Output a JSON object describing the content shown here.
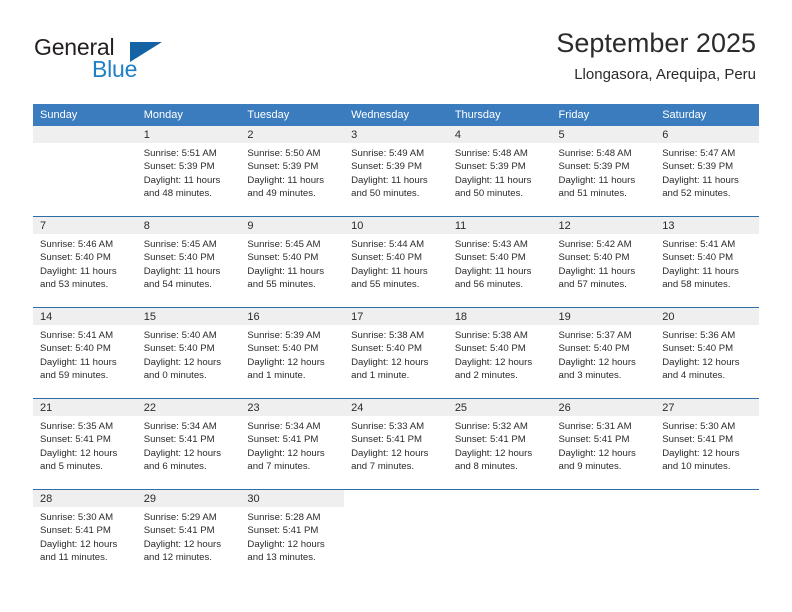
{
  "brand": {
    "name_part1": "General",
    "name_part2": "Blue",
    "triangle_color": "#1464a5",
    "blue_text_color": "#1f7fc4"
  },
  "header": {
    "title": "September 2025",
    "subtitle": "Llongasora, Arequipa, Peru"
  },
  "theme": {
    "header_bg": "#3a7cbe",
    "row_divider": "#2f6da9",
    "daynum_bg": "#efefef",
    "cell_bg": "#ffffff",
    "text": "#2b2b2b"
  },
  "weekday_headers": [
    "Sunday",
    "Monday",
    "Tuesday",
    "Wednesday",
    "Thursday",
    "Friday",
    "Saturday"
  ],
  "weeks": [
    {
      "days": [
        {
          "day": "",
          "empty": true,
          "sunrise": "",
          "sunset": "",
          "daylight_line1": "",
          "daylight_line2": ""
        },
        {
          "day": "1",
          "sunrise": "Sunrise: 5:51 AM",
          "sunset": "Sunset: 5:39 PM",
          "daylight_line1": "Daylight: 11 hours",
          "daylight_line2": "and 48 minutes."
        },
        {
          "day": "2",
          "sunrise": "Sunrise: 5:50 AM",
          "sunset": "Sunset: 5:39 PM",
          "daylight_line1": "Daylight: 11 hours",
          "daylight_line2": "and 49 minutes."
        },
        {
          "day": "3",
          "sunrise": "Sunrise: 5:49 AM",
          "sunset": "Sunset: 5:39 PM",
          "daylight_line1": "Daylight: 11 hours",
          "daylight_line2": "and 50 minutes."
        },
        {
          "day": "4",
          "sunrise": "Sunrise: 5:48 AM",
          "sunset": "Sunset: 5:39 PM",
          "daylight_line1": "Daylight: 11 hours",
          "daylight_line2": "and 50 minutes."
        },
        {
          "day": "5",
          "sunrise": "Sunrise: 5:48 AM",
          "sunset": "Sunset: 5:39 PM",
          "daylight_line1": "Daylight: 11 hours",
          "daylight_line2": "and 51 minutes."
        },
        {
          "day": "6",
          "sunrise": "Sunrise: 5:47 AM",
          "sunset": "Sunset: 5:39 PM",
          "daylight_line1": "Daylight: 11 hours",
          "daylight_line2": "and 52 minutes."
        }
      ]
    },
    {
      "days": [
        {
          "day": "7",
          "sunrise": "Sunrise: 5:46 AM",
          "sunset": "Sunset: 5:40 PM",
          "daylight_line1": "Daylight: 11 hours",
          "daylight_line2": "and 53 minutes."
        },
        {
          "day": "8",
          "sunrise": "Sunrise: 5:45 AM",
          "sunset": "Sunset: 5:40 PM",
          "daylight_line1": "Daylight: 11 hours",
          "daylight_line2": "and 54 minutes."
        },
        {
          "day": "9",
          "sunrise": "Sunrise: 5:45 AM",
          "sunset": "Sunset: 5:40 PM",
          "daylight_line1": "Daylight: 11 hours",
          "daylight_line2": "and 55 minutes."
        },
        {
          "day": "10",
          "sunrise": "Sunrise: 5:44 AM",
          "sunset": "Sunset: 5:40 PM",
          "daylight_line1": "Daylight: 11 hours",
          "daylight_line2": "and 55 minutes."
        },
        {
          "day": "11",
          "sunrise": "Sunrise: 5:43 AM",
          "sunset": "Sunset: 5:40 PM",
          "daylight_line1": "Daylight: 11 hours",
          "daylight_line2": "and 56 minutes."
        },
        {
          "day": "12",
          "sunrise": "Sunrise: 5:42 AM",
          "sunset": "Sunset: 5:40 PM",
          "daylight_line1": "Daylight: 11 hours",
          "daylight_line2": "and 57 minutes."
        },
        {
          "day": "13",
          "sunrise": "Sunrise: 5:41 AM",
          "sunset": "Sunset: 5:40 PM",
          "daylight_line1": "Daylight: 11 hours",
          "daylight_line2": "and 58 minutes."
        }
      ]
    },
    {
      "days": [
        {
          "day": "14",
          "sunrise": "Sunrise: 5:41 AM",
          "sunset": "Sunset: 5:40 PM",
          "daylight_line1": "Daylight: 11 hours",
          "daylight_line2": "and 59 minutes."
        },
        {
          "day": "15",
          "sunrise": "Sunrise: 5:40 AM",
          "sunset": "Sunset: 5:40 PM",
          "daylight_line1": "Daylight: 12 hours",
          "daylight_line2": "and 0 minutes."
        },
        {
          "day": "16",
          "sunrise": "Sunrise: 5:39 AM",
          "sunset": "Sunset: 5:40 PM",
          "daylight_line1": "Daylight: 12 hours",
          "daylight_line2": "and 1 minute."
        },
        {
          "day": "17",
          "sunrise": "Sunrise: 5:38 AM",
          "sunset": "Sunset: 5:40 PM",
          "daylight_line1": "Daylight: 12 hours",
          "daylight_line2": "and 1 minute."
        },
        {
          "day": "18",
          "sunrise": "Sunrise: 5:38 AM",
          "sunset": "Sunset: 5:40 PM",
          "daylight_line1": "Daylight: 12 hours",
          "daylight_line2": "and 2 minutes."
        },
        {
          "day": "19",
          "sunrise": "Sunrise: 5:37 AM",
          "sunset": "Sunset: 5:40 PM",
          "daylight_line1": "Daylight: 12 hours",
          "daylight_line2": "and 3 minutes."
        },
        {
          "day": "20",
          "sunrise": "Sunrise: 5:36 AM",
          "sunset": "Sunset: 5:40 PM",
          "daylight_line1": "Daylight: 12 hours",
          "daylight_line2": "and 4 minutes."
        }
      ]
    },
    {
      "days": [
        {
          "day": "21",
          "sunrise": "Sunrise: 5:35 AM",
          "sunset": "Sunset: 5:41 PM",
          "daylight_line1": "Daylight: 12 hours",
          "daylight_line2": "and 5 minutes."
        },
        {
          "day": "22",
          "sunrise": "Sunrise: 5:34 AM",
          "sunset": "Sunset: 5:41 PM",
          "daylight_line1": "Daylight: 12 hours",
          "daylight_line2": "and 6 minutes."
        },
        {
          "day": "23",
          "sunrise": "Sunrise: 5:34 AM",
          "sunset": "Sunset: 5:41 PM",
          "daylight_line1": "Daylight: 12 hours",
          "daylight_line2": "and 7 minutes."
        },
        {
          "day": "24",
          "sunrise": "Sunrise: 5:33 AM",
          "sunset": "Sunset: 5:41 PM",
          "daylight_line1": "Daylight: 12 hours",
          "daylight_line2": "and 7 minutes."
        },
        {
          "day": "25",
          "sunrise": "Sunrise: 5:32 AM",
          "sunset": "Sunset: 5:41 PM",
          "daylight_line1": "Daylight: 12 hours",
          "daylight_line2": "and 8 minutes."
        },
        {
          "day": "26",
          "sunrise": "Sunrise: 5:31 AM",
          "sunset": "Sunset: 5:41 PM",
          "daylight_line1": "Daylight: 12 hours",
          "daylight_line2": "and 9 minutes."
        },
        {
          "day": "27",
          "sunrise": "Sunrise: 5:30 AM",
          "sunset": "Sunset: 5:41 PM",
          "daylight_line1": "Daylight: 12 hours",
          "daylight_line2": "and 10 minutes."
        }
      ]
    },
    {
      "days": [
        {
          "day": "28",
          "sunrise": "Sunrise: 5:30 AM",
          "sunset": "Sunset: 5:41 PM",
          "daylight_line1": "Daylight: 12 hours",
          "daylight_line2": "and 11 minutes."
        },
        {
          "day": "29",
          "sunrise": "Sunrise: 5:29 AM",
          "sunset": "Sunset: 5:41 PM",
          "daylight_line1": "Daylight: 12 hours",
          "daylight_line2": "and 12 minutes."
        },
        {
          "day": "30",
          "sunrise": "Sunrise: 5:28 AM",
          "sunset": "Sunset: 5:41 PM",
          "daylight_line1": "Daylight: 12 hours",
          "daylight_line2": "and 13 minutes."
        },
        {
          "day": "",
          "blank": true,
          "sunrise": "",
          "sunset": "",
          "daylight_line1": "",
          "daylight_line2": ""
        },
        {
          "day": "",
          "blank": true,
          "sunrise": "",
          "sunset": "",
          "daylight_line1": "",
          "daylight_line2": ""
        },
        {
          "day": "",
          "blank": true,
          "sunrise": "",
          "sunset": "",
          "daylight_line1": "",
          "daylight_line2": ""
        },
        {
          "day": "",
          "blank": true,
          "sunrise": "",
          "sunset": "",
          "daylight_line1": "",
          "daylight_line2": ""
        }
      ]
    }
  ]
}
